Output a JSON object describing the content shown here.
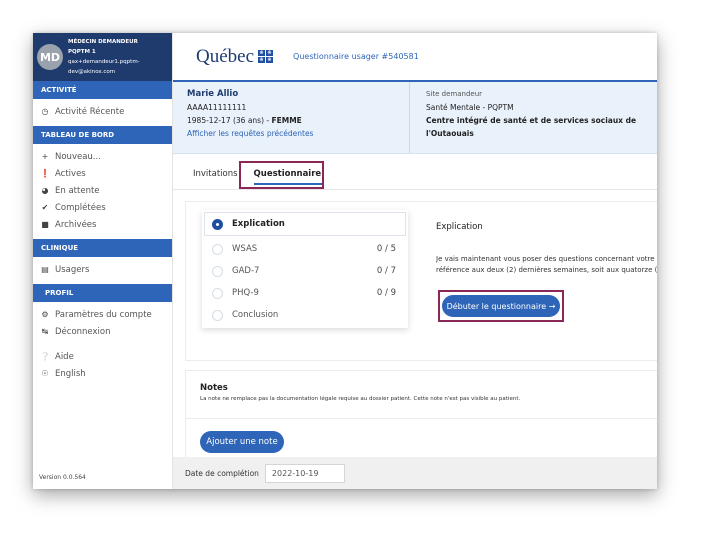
{
  "user": {
    "initials": "MD",
    "role": "MÉDECIN DEMANDEUR",
    "org": "PQPTM 1",
    "email_line1": "qax+demandeur1.pqptm-",
    "email_line2": "dev@akinox.com"
  },
  "sidebar": {
    "activity_head": "ACTIVITÉ",
    "activity_items": [
      {
        "icon": "clock-icon",
        "label": "Activité Récente"
      }
    ],
    "dashboard_head": "TABLEAU DE BORD",
    "dashboard_items": [
      {
        "icon": "plus-icon",
        "label": "Nouveau..."
      },
      {
        "icon": "alert-icon",
        "label": "Actives"
      },
      {
        "icon": "pending-icon",
        "label": "En attente"
      },
      {
        "icon": "check-icon",
        "label": "Complétées"
      },
      {
        "icon": "folder-icon",
        "label": "Archivées"
      }
    ],
    "clinic_head": "CLINIQUE",
    "clinic_items": [
      {
        "icon": "users-icon",
        "label": "Usagers"
      }
    ],
    "profile_head": "PROFIL",
    "profile_items": [
      {
        "icon": "gear-icon",
        "label": "Paramètres du compte"
      },
      {
        "icon": "logout-icon",
        "label": "Déconnexion"
      }
    ],
    "misc_items": [
      {
        "icon": "help-icon",
        "label": "Aide"
      },
      {
        "icon": "globe-icon",
        "label": "English"
      }
    ],
    "version": "Version 0.0.564"
  },
  "header": {
    "brand": "Québec",
    "questionnaire_title": "Questionnaire usager #540581"
  },
  "patient": {
    "name": "Marie Allio",
    "id": "AAAA11111111",
    "dob": "1985-12-17 (36 ans) - ",
    "sex": "FEMME",
    "history_link": "Afficher les requêtes précédentes",
    "site_label": "Site demandeur",
    "site": "Santé Mentale - PQPTM",
    "center_line1": "Centre intégré de santé et de services sociaux de",
    "center_line2": "l'Outaouais"
  },
  "tabs": [
    {
      "label": "Invitations",
      "active": false
    },
    {
      "label": "Questionnaire",
      "active": true
    }
  ],
  "steps": [
    {
      "label": "Explication",
      "score": "",
      "active": true
    },
    {
      "label": "WSAS",
      "score": "0 / 5",
      "active": false
    },
    {
      "label": "GAD-7",
      "score": "0 / 7",
      "active": false
    },
    {
      "label": "PHQ-9",
      "score": "0 / 9",
      "active": false
    },
    {
      "label": "Conclusion",
      "score": "",
      "active": false
    }
  ],
  "explanation": {
    "title": "Explication",
    "line1": "Je vais maintenant vous poser des questions concernant votre",
    "line2": "référence aux deux (2) dernières semaines, soit aux quatorze (1",
    "start_button": "Débuter le questionnaire →"
  },
  "notes": {
    "title": "Notes",
    "subtitle": "La note ne remplace pas la documentation légale requise au dossier patient. Cette note n'est pas visible au patient.",
    "add_button": "Ajouter une note"
  },
  "footer": {
    "completion_label": "Date de complétion",
    "completion_date": "2022-10-19"
  },
  "colors": {
    "primary": "#2e65b8",
    "navy": "#1f3b6e",
    "highlight": "#8a2757"
  }
}
